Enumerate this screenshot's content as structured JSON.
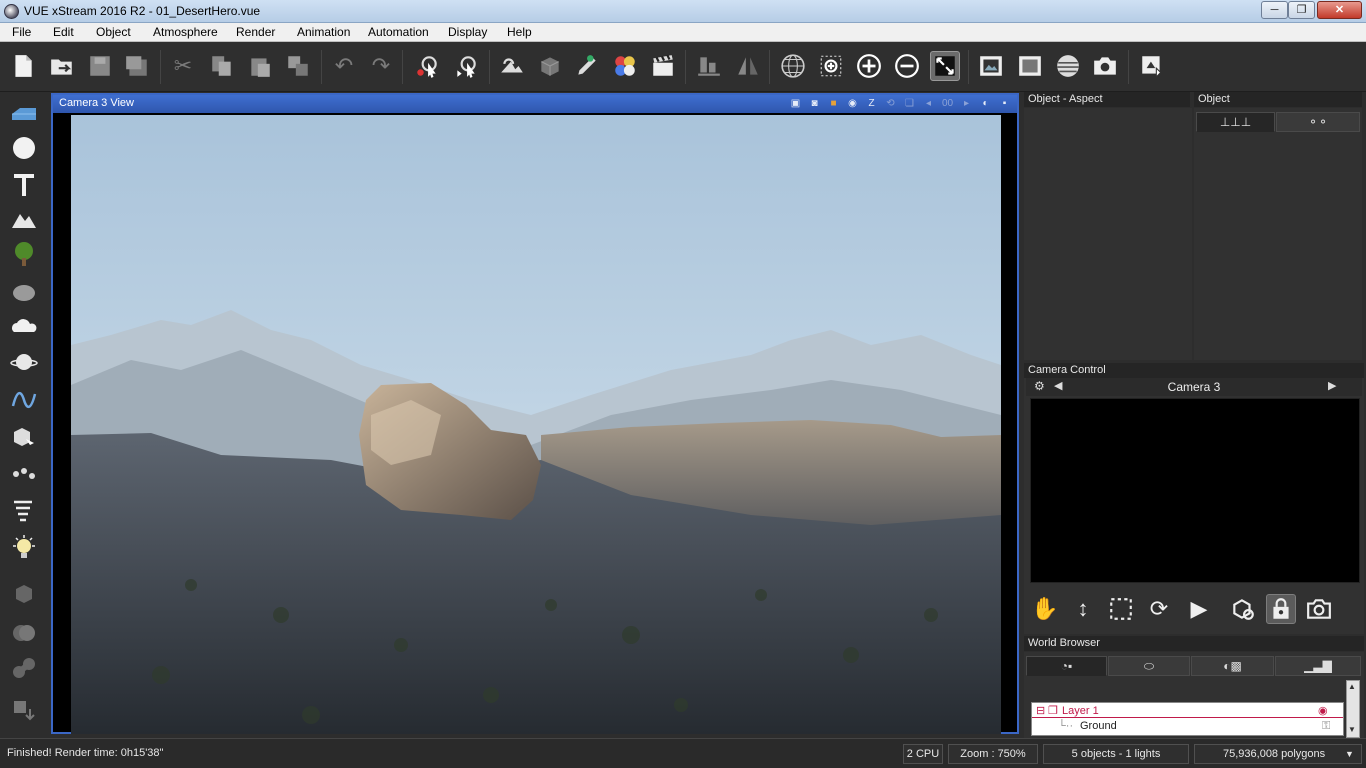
{
  "window": {
    "title": "VUE xStream 2016 R2 - 01_DesertHero.vue",
    "min": "─",
    "max": "❐",
    "close": "✕"
  },
  "menu": [
    "File",
    "Edit",
    "Object",
    "Atmosphere",
    "Render",
    "Animation",
    "Automation",
    "Display",
    "Help"
  ],
  "toolbar": {
    "icons": [
      "new-file-icon",
      "open-file-icon",
      "save-icon",
      "save-as-icon",
      "cut-icon",
      "copy-icon",
      "paste-icon",
      "duplicate-icon",
      "undo-icon",
      "redo-icon",
      "select-icon",
      "select-drag-icon",
      "atmosphere-icon",
      "material-icon",
      "brush-icon",
      "colors-icon",
      "animation-clapper-icon",
      "align-icon",
      "mirror-icon",
      "globe-icon",
      "zoom-region-icon",
      "zoom-in-icon",
      "zoom-out-icon",
      "fit-view-icon",
      "render-screen-icon",
      "render-area-icon",
      "render-sphere-icon",
      "camera-icon",
      "export-icon"
    ]
  },
  "left_tools": [
    "plane-icon",
    "sphere-icon",
    "text-icon",
    "terrain-icon",
    "plant-icon",
    "rock-icon",
    "cloud-icon",
    "planet-icon",
    "curve-icon",
    "object-import-icon",
    "path-icon",
    "wind-icon",
    "light-icon",
    "group-icon",
    "boolean-icon",
    "metablob-icon",
    "drop-icon"
  ],
  "viewport": {
    "title": "Camera 3 View",
    "header_icons": [
      "camera-icon",
      "render-icon",
      "frame-icon",
      "focus-icon",
      "chevron-down-icon",
      "z-label",
      "loop-icon",
      "layers-icon",
      "prev-icon",
      "infinity-icon",
      "next-icon",
      "pie-icon",
      "save-view-icon"
    ],
    "z_label": "Z",
    "infinity_label": "00"
  },
  "panels": {
    "object_aspect": {
      "title": "Object - Aspect"
    },
    "object": {
      "title": "Object"
    },
    "camera_control": {
      "title": "Camera Control",
      "camera_name": "Camera 3"
    },
    "world_browser": {
      "title": "World Browser",
      "rows": [
        {
          "label": "Layer 1"
        },
        {
          "label": "Ground"
        }
      ]
    }
  },
  "status": {
    "message": "Finished! Render time: 0h15'38\"",
    "cpu": "2 CPU",
    "zoom": "Zoom : 750%",
    "objects": "5 objects - 1 lights",
    "polygons": "75,936,008 polygons"
  },
  "colors": {
    "viewport_border": "#3b67c6",
    "panel_bg": "#313131",
    "status_bg": "#2a2a2a",
    "selection_red": "#c01a4a"
  }
}
